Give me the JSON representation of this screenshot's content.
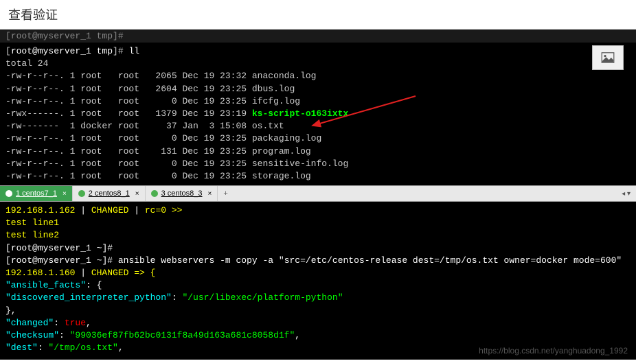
{
  "header": {
    "title": "查看验证"
  },
  "terminal1": {
    "blur_line": "[root@myserver_1 tmp]#",
    "prompt_line": {
      "prefix": "[",
      "userpath": "root@myserver_1 tmp",
      "suffix": "]# ",
      "cmd": "ll"
    },
    "total_line": "total 24",
    "rows": [
      {
        "perm": "-rw-r--r--.",
        "n": "1",
        "own": "root  ",
        "grp": "root ",
        "size": " 2065",
        "date": "Dec 19 23:32",
        "name": "anaconda.log",
        "cls": "file-normal"
      },
      {
        "perm": "-rw-r--r--.",
        "n": "1",
        "own": "root  ",
        "grp": "root ",
        "size": " 2604",
        "date": "Dec 19 23:25",
        "name": "dbus.log",
        "cls": "file-normal"
      },
      {
        "perm": "-rw-r--r--.",
        "n": "1",
        "own": "root  ",
        "grp": "root ",
        "size": "    0",
        "date": "Dec 19 23:25",
        "name": "ifcfg.log",
        "cls": "file-normal"
      },
      {
        "perm": "-rwx------.",
        "n": "1",
        "own": "root  ",
        "grp": "root ",
        "size": " 1379",
        "date": "Dec 19 23:19",
        "name": "ks-script-o163ixtx",
        "cls": "file-green"
      },
      {
        "perm": "-rw-------",
        "n": " 1",
        "own": "docker",
        "grp": "root ",
        "size": "   37",
        "date": "Jan  3 15:08",
        "name": "os.txt",
        "cls": "file-normal"
      },
      {
        "perm": "-rw-r--r--.",
        "n": "1",
        "own": "root  ",
        "grp": "root ",
        "size": "    0",
        "date": "Dec 19 23:25",
        "name": "packaging.log",
        "cls": "file-normal"
      },
      {
        "perm": "-rw-r--r--.",
        "n": "1",
        "own": "root  ",
        "grp": "root ",
        "size": "  131",
        "date": "Dec 19 23:25",
        "name": "program.log",
        "cls": "file-normal"
      },
      {
        "perm": "-rw-r--r--.",
        "n": "1",
        "own": "root  ",
        "grp": "root ",
        "size": "    0",
        "date": "Dec 19 23:25",
        "name": "sensitive-info.log",
        "cls": "file-normal"
      },
      {
        "perm": "-rw-r--r--.",
        "n": "1",
        "own": "root  ",
        "grp": "root ",
        "size": "    0",
        "date": "Dec 19 23:25",
        "name": "storage.log",
        "cls": "file-normal"
      }
    ]
  },
  "tabs": [
    {
      "label": "1 centos7_1",
      "active": true
    },
    {
      "label": "2 centos8_1",
      "active": false
    },
    {
      "label": "3 centos8_3",
      "active": false
    }
  ],
  "terminal2": {
    "line1": {
      "host": "192.168.1.162",
      "sep": " | ",
      "status": "CHANGED",
      "sep2": " | ",
      "rc": "rc=0",
      "arrow": " >>"
    },
    "line2": "test line1",
    "line3": "test line2",
    "prompt1": {
      "prefix": "[",
      "userpath": "root@myserver_1 ~",
      "suffix": "]#"
    },
    "prompt2": {
      "prefix": "[",
      "userpath": "root@myserver_1 ~",
      "suffix": "]# ",
      "cmd": "ansible webservers -m copy -a ",
      "args": "\"src=/etc/centos-release dest=/tmp/os.txt owner=docker mode=600\""
    },
    "line6": {
      "host": "192.168.1.160",
      "sep": " | ",
      "status": "CHANGED",
      "arrow": " => {"
    },
    "facts": {
      "key": "\"ansible_facts\"",
      "colon": ": {",
      "inner_key": "\"discovered_interpreter_python\"",
      "inner_sep": ": ",
      "inner_val": "\"/usr/libexec/platform-python\"",
      "close": "    },"
    },
    "changed": {
      "key": "\"changed\"",
      "sep": ": ",
      "val": "true",
      "comma": ","
    },
    "checksum": {
      "key": "\"checksum\"",
      "sep": ": ",
      "val": "\"99036ef87fb62bc0131f8a49d163a681c8058d1f\"",
      "comma": ","
    },
    "dest": {
      "key": "\"dest\"",
      "sep": ": ",
      "val": "\"/tmp/os.txt\"",
      "comma": ","
    }
  },
  "watermark": "https://blog.csdn.net/yanghuadong_1992"
}
